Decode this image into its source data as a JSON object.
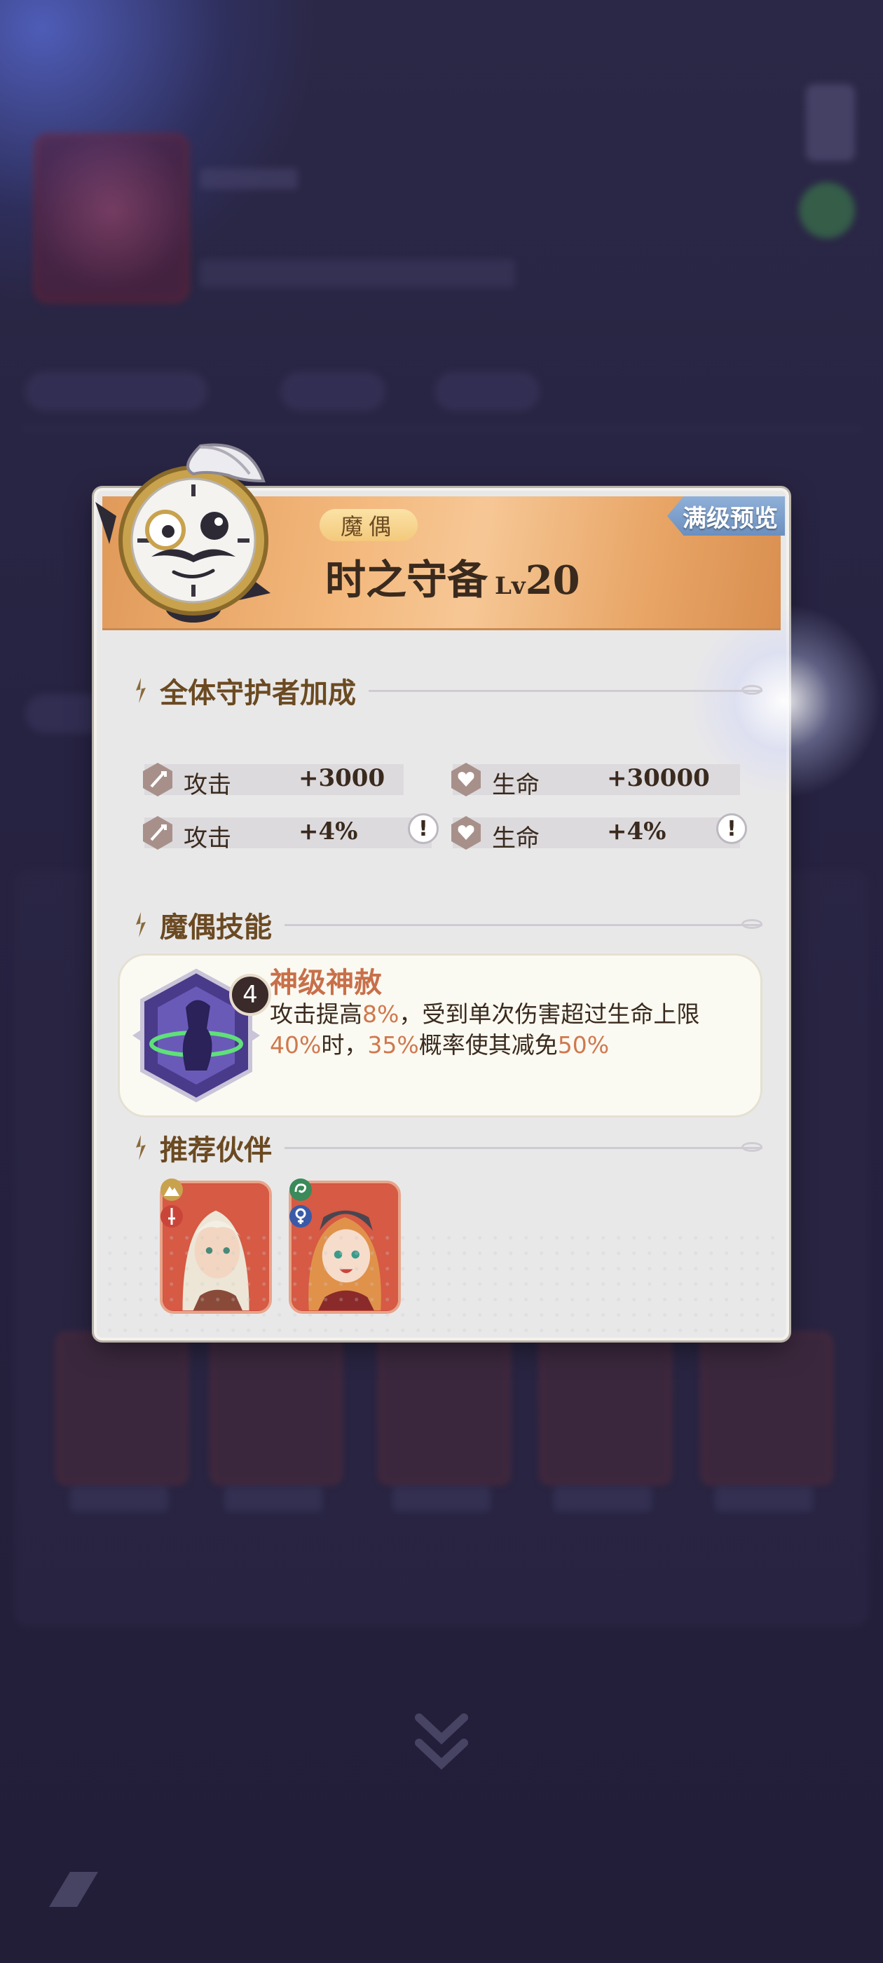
{
  "modal": {
    "badge": "满级预览",
    "type_label": "魔偶",
    "name": "时之守备",
    "level_prefix": "Lv",
    "level": "20"
  },
  "bonus_section": {
    "title": "全体守护者加成",
    "stats": [
      {
        "name": "攻击",
        "value": "+3000",
        "icon": "attack-icon"
      },
      {
        "name": "生命",
        "value": "+30000",
        "icon": "health-icon"
      },
      {
        "name": "攻击",
        "value": "+4%",
        "icon": "attack-icon",
        "info": "!"
      },
      {
        "name": "生命",
        "value": "+4%",
        "icon": "health-icon",
        "info": "!"
      }
    ]
  },
  "skill_section": {
    "title": "魔偶技能",
    "skill": {
      "level": "4",
      "name": "神级神赦",
      "desc_parts": [
        "攻击提高",
        "8%",
        "，受到单次伤害超过生命上限",
        "40%",
        "时，",
        "35%",
        "概率使其减免",
        "50%"
      ]
    }
  },
  "partner_section": {
    "title": "推荐伙伴",
    "partners": [
      {
        "name": "partner-white-hair",
        "role_icons": [
          "mountain-icon",
          "sword-icon"
        ]
      },
      {
        "name": "partner-orange-hair",
        "role_icons": [
          "swirl-icon",
          "venus-icon"
        ]
      }
    ]
  },
  "colors": {
    "accent_orange": "#d0784e",
    "title_brown": "#6b4a22",
    "badge_blue": "#6c8fbe",
    "card_red": "#c9453a"
  }
}
